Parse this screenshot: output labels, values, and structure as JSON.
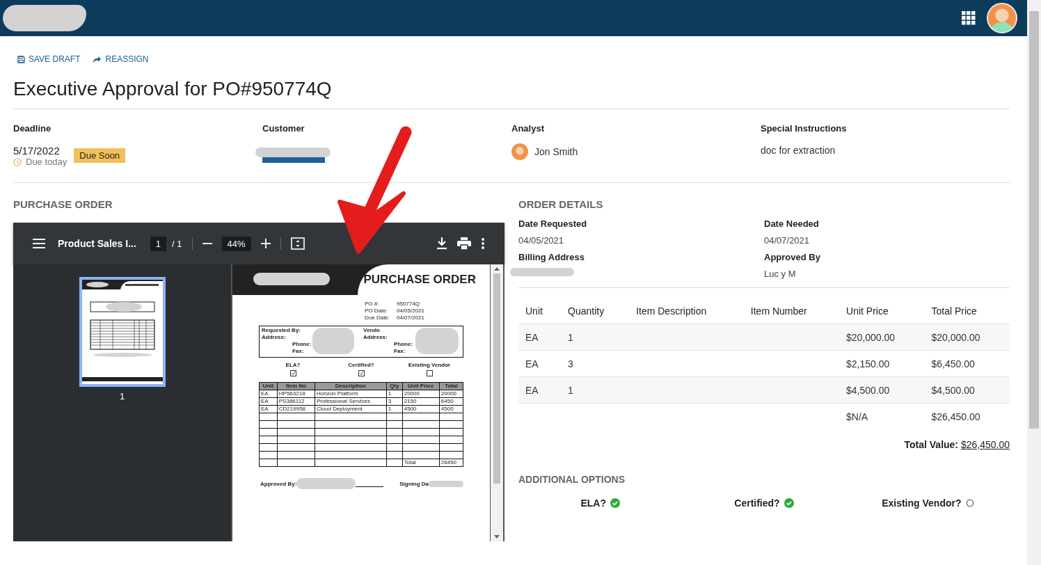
{
  "actions": [
    {
      "kind": "save",
      "label": "SAVE DRAFT"
    },
    {
      "kind": "reassign",
      "label": "REASSIGN"
    }
  ],
  "title": "Executive Approval for PO#950774Q",
  "summary": {
    "deadline": {
      "label": "Deadline",
      "date": "5/17/2022",
      "note": "Due today",
      "badge": "Due Soon"
    },
    "customer": {
      "label": "Customer"
    },
    "analyst": {
      "label": "Analyst",
      "name": "Jon Smith"
    },
    "special_instructions": {
      "label": "Special Instructions",
      "text": "doc for extraction"
    }
  },
  "purchase_order": {
    "heading": "PURCHASE ORDER",
    "viewer": {
      "file_name": "Product Sales I...",
      "page": "1",
      "page_count": "/ 1",
      "zoom": "44%",
      "thumbnail": {
        "label": "1",
        "selected": true
      },
      "document": {
        "title": "PURCHASE ORDER",
        "meta": [
          {
            "label": "PO #:",
            "value": "950774Q"
          },
          {
            "label": "PO Date:",
            "value": "04/05/2021"
          },
          {
            "label": "Due Date:",
            "value": "04/07/2021"
          }
        ],
        "requester_labels": [
          "Requested By:",
          "Address:",
          "Phone:",
          "Fax:"
        ],
        "vendor_labels": [
          "Vendo",
          "Address:",
          "Phone:",
          "Fax:"
        ],
        "checks": [
          {
            "label": "ELA?",
            "checked": true
          },
          {
            "label": "Certified?",
            "checked": true
          },
          {
            "label": "Existing Vendor",
            "checked": false
          }
        ],
        "columns": [
          "Unit",
          "Item No",
          "Description",
          "Qty",
          "Unit Price",
          "Total"
        ],
        "rows": [
          [
            "EA",
            "HP563218",
            "Horizon Platform",
            "1",
            "20000",
            "20000"
          ],
          [
            "EA",
            "PS386112",
            "Professional Services",
            "3",
            "2150",
            "6450"
          ],
          [
            "EA",
            "CD219958",
            "Cloud Deployment",
            "1",
            "4500",
            "4500"
          ]
        ],
        "total_label": "Total",
        "total_value": "26450",
        "signature_labels": [
          "Approved By:",
          "Signing Da"
        ]
      }
    }
  },
  "order_details": {
    "heading": "ORDER DETAILS",
    "fields": [
      {
        "label": "Date Requested",
        "value": "04/05/2021"
      },
      {
        "label": "Date Needed",
        "value": "04/07/2021"
      },
      {
        "label": "Billing Address"
      },
      {
        "label": "Approved By",
        "value": "Luc y M"
      }
    ],
    "columns": [
      "Unit",
      "Quantity",
      "Item Description",
      "Item Number",
      "Unit Price",
      "Total Price"
    ],
    "rows": [
      [
        "EA",
        "1",
        "",
        "",
        "$20,000.00",
        "$20,000.00"
      ],
      [
        "EA",
        "3",
        "",
        "",
        "$2,150.00",
        "$6,450.00"
      ],
      [
        "EA",
        "1",
        "",
        "",
        "$4,500.00",
        "$4,500.00"
      ],
      [
        "",
        "",
        "",
        "",
        "$N/A",
        "$26,450.00"
      ]
    ],
    "total_label": "Total Value:",
    "total_value": "$26,450.00"
  },
  "additional_options": {
    "heading": "ADDITIONAL OPTIONS",
    "options": [
      {
        "label": "ELA?",
        "checked": true
      },
      {
        "label": "Certified?",
        "checked": true
      },
      {
        "label": "Existing Vendor?",
        "checked": false
      }
    ]
  }
}
